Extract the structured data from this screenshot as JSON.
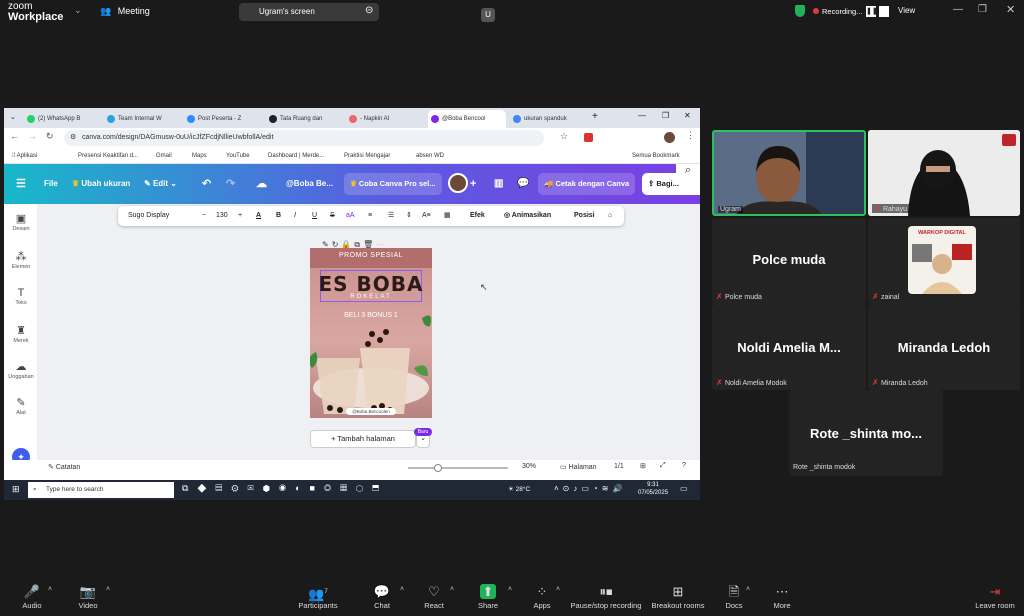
{
  "zoom": {
    "logo": {
      "line1": "zoom",
      "line2": "Workplace"
    },
    "meeting_label": "Meeting",
    "screen_pill": {
      "avatar": "U",
      "label": "Ugram's screen"
    },
    "recording_label": "Recording...",
    "view_label": "View",
    "toolbar": [
      {
        "icon": "🎤",
        "label": "Audio",
        "name": "audio-button"
      },
      {
        "icon": "📷",
        "label": "Video",
        "name": "video-button"
      },
      {
        "icon": "👥",
        "label": "Participants",
        "badge": "7",
        "name": "participants-button"
      },
      {
        "icon": "💬",
        "label": "Chat",
        "name": "chat-button"
      },
      {
        "icon": "♡",
        "label": "React",
        "name": "react-button"
      },
      {
        "icon": "⬆",
        "label": "Share",
        "name": "share-button"
      },
      {
        "icon": "▦",
        "label": "Apps",
        "name": "apps-button"
      },
      {
        "icon": "⏸",
        "label": "Pause/stop recording",
        "name": "pause-recording-button"
      },
      {
        "icon": "▦",
        "label": "Breakout rooms",
        "name": "breakout-rooms-button"
      },
      {
        "icon": "📄",
        "label": "Docs",
        "name": "docs-button"
      },
      {
        "icon": "⋯",
        "label": "More",
        "name": "more-button"
      }
    ],
    "leave_label": "Leave room",
    "participants": [
      {
        "name": "Ugram"
      },
      {
        "name": "Rahayu"
      },
      {
        "name": "Polce muda",
        "big": "Polce muda"
      },
      {
        "name": "zainal",
        "thumb_text": "WARKOP DIGITAL"
      },
      {
        "name": "Noldi Amelia Modok",
        "big": "Noldi Amelia M..."
      },
      {
        "name": "Miranda Ledoh",
        "big": "Miranda Ledoh"
      },
      {
        "name": "Rote _shinta modok",
        "big": "Rote _shinta mo..."
      }
    ]
  },
  "browser": {
    "tabs": [
      "(2) WhatsApp B",
      "Team Internal W",
      "Post Peserta - Z",
      "Tata Ruang dan",
      "- Napkin AI",
      "@Boba Bencool",
      "ukuran spanduk"
    ],
    "url": "canva.com/design/DAGmusw-0uU/icJfZFcdjNllieUwbfollA/edit",
    "bookmarks": [
      "Aplikasi",
      "Presensi Keaktifan d...",
      "Gmail",
      "Maps",
      "YouTube",
      "Dashboard | Merde...",
      "Praktisi Mengajar",
      "absen WD"
    ],
    "all_bookmarks": "Semua Bookmark"
  },
  "canva": {
    "file": "File",
    "resize": "Ubah ukuran",
    "edit": "Edit",
    "doc_title": "@Boba Be...",
    "promo": "Coba Canva Pro sel...",
    "print": "Cetak dengan Canva",
    "share": "Bagi...",
    "sidebar": [
      "Desain",
      "Elemen",
      "Teks",
      "Merek",
      "Unggahan",
      "Alat"
    ],
    "font": "Sugo Display",
    "font_size": "130",
    "text_tools": {
      "effect": "Efek",
      "animate": "Animasikan",
      "position": "Posisi"
    },
    "poster": {
      "promo": "PROMO SPESIAL",
      "title": "ES BOBA",
      "subtitle": "ROKELAT",
      "offer": "BELI 3 BONUS 1",
      "handle": "@Boba Bencoolen"
    },
    "add_page": "+ Tambah halaman",
    "new_badge": "Baru",
    "notes": "Catatan",
    "zoom": "30%",
    "pages_label": "Halaman",
    "page_count": "1/1"
  },
  "taskbar": {
    "search": "Type here to search",
    "weather": "28°C",
    "time": "9:31",
    "date": "07/05/2025"
  }
}
